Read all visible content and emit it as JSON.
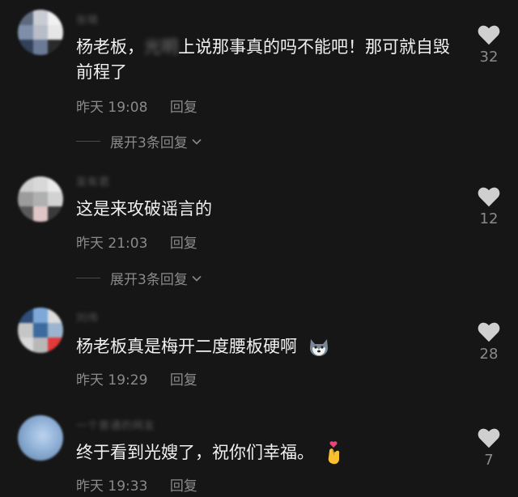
{
  "comments": [
    {
      "username": "张晓",
      "text_before": "杨老板，",
      "text_blurred": "光明",
      "text_after": "上说那事真的吗不能吧！那可就自毁前程了",
      "time": "昨天 19:08",
      "reply_label": "回复",
      "likes": "32",
      "expand_label": "展开3条回复"
    },
    {
      "username": "吴有君",
      "text": "这是来攻破谣言的",
      "time": "昨天 21:03",
      "reply_label": "回复",
      "likes": "12",
      "expand_label": "展开3条回复"
    },
    {
      "username": "刘伟",
      "text": "杨老板真是梅开二度腰板硬啊",
      "emoji": "husky-face",
      "time": "昨天 19:29",
      "reply_label": "回复",
      "likes": "28"
    },
    {
      "username": "一个普通的网友",
      "text": "终于看到光嫂了，祝你们幸福。",
      "emoji": "finger-heart",
      "time": "昨天 19:33",
      "reply_label": "回复",
      "likes": "7"
    }
  ],
  "colors": {
    "background": "#161616",
    "text": "#f0f0f0",
    "secondary": "#8a8a8a",
    "heart": "#cfcfcf"
  },
  "icons": [
    "heart-icon",
    "chevron-down-icon",
    "husky-emoji-icon",
    "finger-heart-emoji-icon"
  ]
}
